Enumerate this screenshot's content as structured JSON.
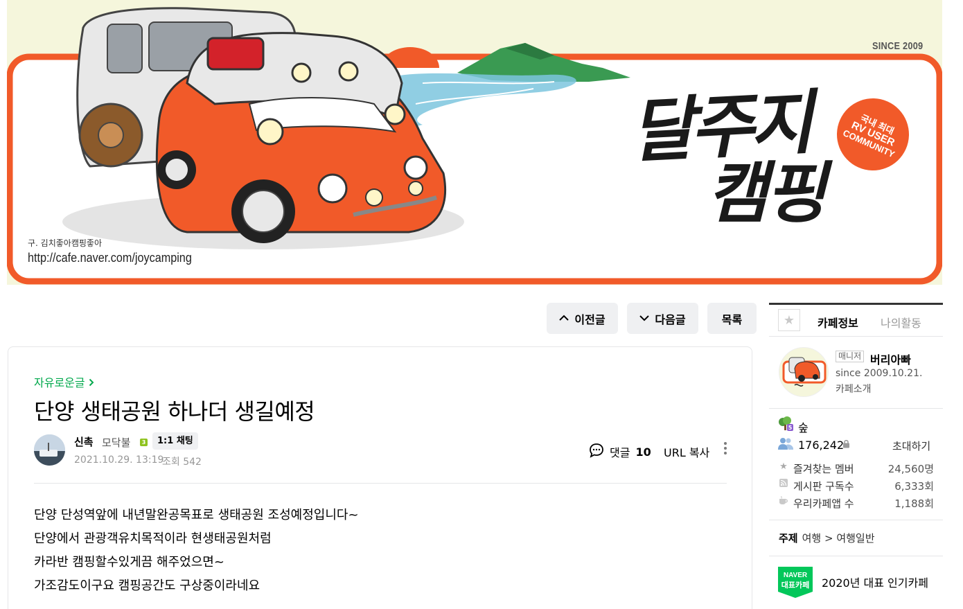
{
  "banner": {
    "since": "SINCE 2009",
    "old_name": "구. 김치좋아캠핑좋아",
    "url": "http://cafe.naver.com/joycamping",
    "stamp": [
      "국내 최대",
      "RV USER",
      "COMMUNITY"
    ],
    "logo_line1": "달주지",
    "logo_line2": "캠핑"
  },
  "nav": {
    "prev": "이전글",
    "next": "다음글",
    "list": "목록"
  },
  "article": {
    "board": "자유로운글",
    "title": "단양 생태공원 하나더 생길예정",
    "author": "신촉",
    "rank": "모닥불",
    "chat": "1:1 채팅",
    "date": "2021.10.29. 13:19",
    "views": "조회 542",
    "comment_label": "댓글",
    "comment_count": "10",
    "url_copy": "URL 복사",
    "body": [
      "단양 단성역앞에 내년말완공목표로 생태공원 조성예정입니다~",
      "단양에서 관광객유치목적이라 현생태공원처럼",
      "카라반 캠핑할수있게끔 해주었으면~",
      "가조감도이구요 캠핑공간도 구상중이라네요"
    ]
  },
  "sidebar": {
    "tab_cafe": "카페정보",
    "tab_my": "나의활동",
    "manager_tag": "매니저",
    "manager_name": "버리아빠",
    "since": "since 2009.10.21.",
    "intro": "카페소개",
    "grade": "숲",
    "members": "176,242",
    "invite": "초대하기",
    "stats": [
      {
        "label": "즐겨찾는 멤버",
        "value": "24,560명",
        "icon": "star-icon"
      },
      {
        "label": "게시판 구독수",
        "value": "6,333회",
        "icon": "rss-icon"
      },
      {
        "label": "우리카페앱 수",
        "value": "1,188회",
        "icon": "app-icon"
      }
    ],
    "topic_label": "주제",
    "topic_value": "여행 > 여행일반",
    "naver_badge": [
      "NAVER",
      "대표카페"
    ],
    "award": "2020년 대표 인기카페"
  },
  "colors": {
    "accent_green": "#03a94d",
    "banner_orange": "#f15a29",
    "button_bg": "#eff0f2"
  }
}
